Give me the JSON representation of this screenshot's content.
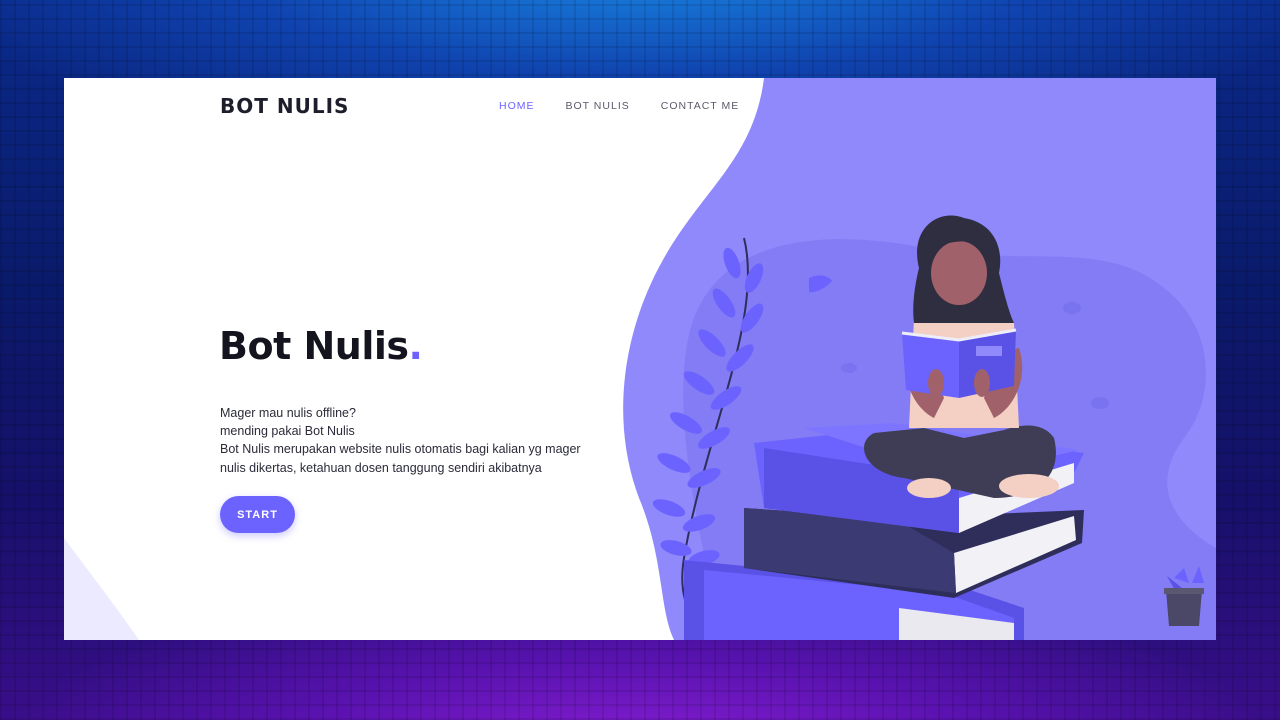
{
  "nav": {
    "brand": "BOT NULIS",
    "links": [
      {
        "label": "HOME",
        "active": true
      },
      {
        "label": "BOT NULIS",
        "active": false
      },
      {
        "label": "CONTACT ME",
        "active": false
      }
    ]
  },
  "hero": {
    "title": "Bot Nulis",
    "title_dot": ".",
    "description_lines": [
      "Mager mau nulis offline?",
      "mending pakai Bot Nulis",
      "Bot Nulis merupakan website nulis otomatis bagi kalian yg mager",
      "nulis dikertas, ketahuan dosen tanggung sendiri akibatnya"
    ],
    "cta_label": "START"
  },
  "illustration": {
    "subject": "woman reading a book sitting on stacked books",
    "icons": [
      "plant-leaf-icon",
      "book-stack-icon",
      "flower-pot-icon"
    ]
  },
  "colors": {
    "accent": "#6c63ff",
    "blob": "#8c86fb",
    "blob_dark": "#7a73f0",
    "text_dark": "#14141f",
    "book_dark": "#2f2e5b"
  }
}
